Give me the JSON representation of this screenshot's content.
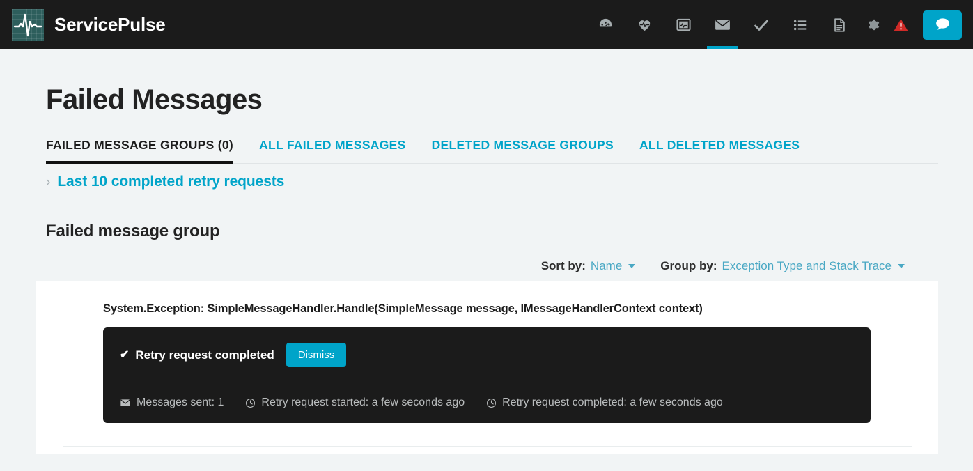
{
  "brand": {
    "name": "ServicePulse",
    "logo_icon": "pulse-waveform-icon"
  },
  "navbar": {
    "items": [
      {
        "icon": "gauge-dashboard-icon",
        "label": "Dashboard",
        "active": false
      },
      {
        "icon": "heart-pulse-icon",
        "label": "Heartbeats",
        "active": false
      },
      {
        "icon": "monitoring-screen-icon",
        "label": "Monitoring",
        "active": false
      },
      {
        "icon": "envelope-icon",
        "label": "Failed Messages",
        "active": true
      },
      {
        "icon": "check-icon",
        "label": "Custom Checks",
        "active": false
      },
      {
        "icon": "list-icon",
        "label": "Events",
        "active": false
      },
      {
        "icon": "document-icon",
        "label": "Documentation",
        "active": false
      }
    ],
    "gear_icon": "gear-icon",
    "alert_icon": "warning-triangle-icon",
    "feedback_icon": "chat-bubble-icon",
    "accent_color": "#00a4c9",
    "alert_color": "#cf2a27",
    "background_color": "#1b1b1b"
  },
  "page": {
    "title": "Failed Messages",
    "tabs": [
      {
        "label": "FAILED MESSAGE GROUPS (0)",
        "active": true
      },
      {
        "label": "ALL FAILED MESSAGES",
        "active": false
      },
      {
        "label": "DELETED MESSAGE GROUPS",
        "active": false
      },
      {
        "label": "ALL DELETED MESSAGES",
        "active": false
      }
    ],
    "retry_requests_link": "Last 10 completed retry requests",
    "retry_requests_chevron": "›",
    "group_heading": "Failed message group"
  },
  "controls": {
    "sort": {
      "label": "Sort by:",
      "value": "Name"
    },
    "group": {
      "label": "Group by:",
      "value": "Exception Type and Stack Trace"
    }
  },
  "card": {
    "exception_title": "System.Exception: SimpleMessageHandler.Handle(SimpleMessage message, IMessageHandlerContext context)",
    "retry_panel": {
      "status_text": "Retry request completed",
      "status_icon": "check-icon",
      "dismiss_label": "Dismiss",
      "meta": [
        {
          "icon": "envelope-icon",
          "text": "Messages sent: 1"
        },
        {
          "icon": "clock-icon",
          "text": "Retry request started: a few seconds ago"
        },
        {
          "icon": "clock-icon",
          "text": "Retry request completed: a few seconds ago"
        }
      ]
    }
  }
}
